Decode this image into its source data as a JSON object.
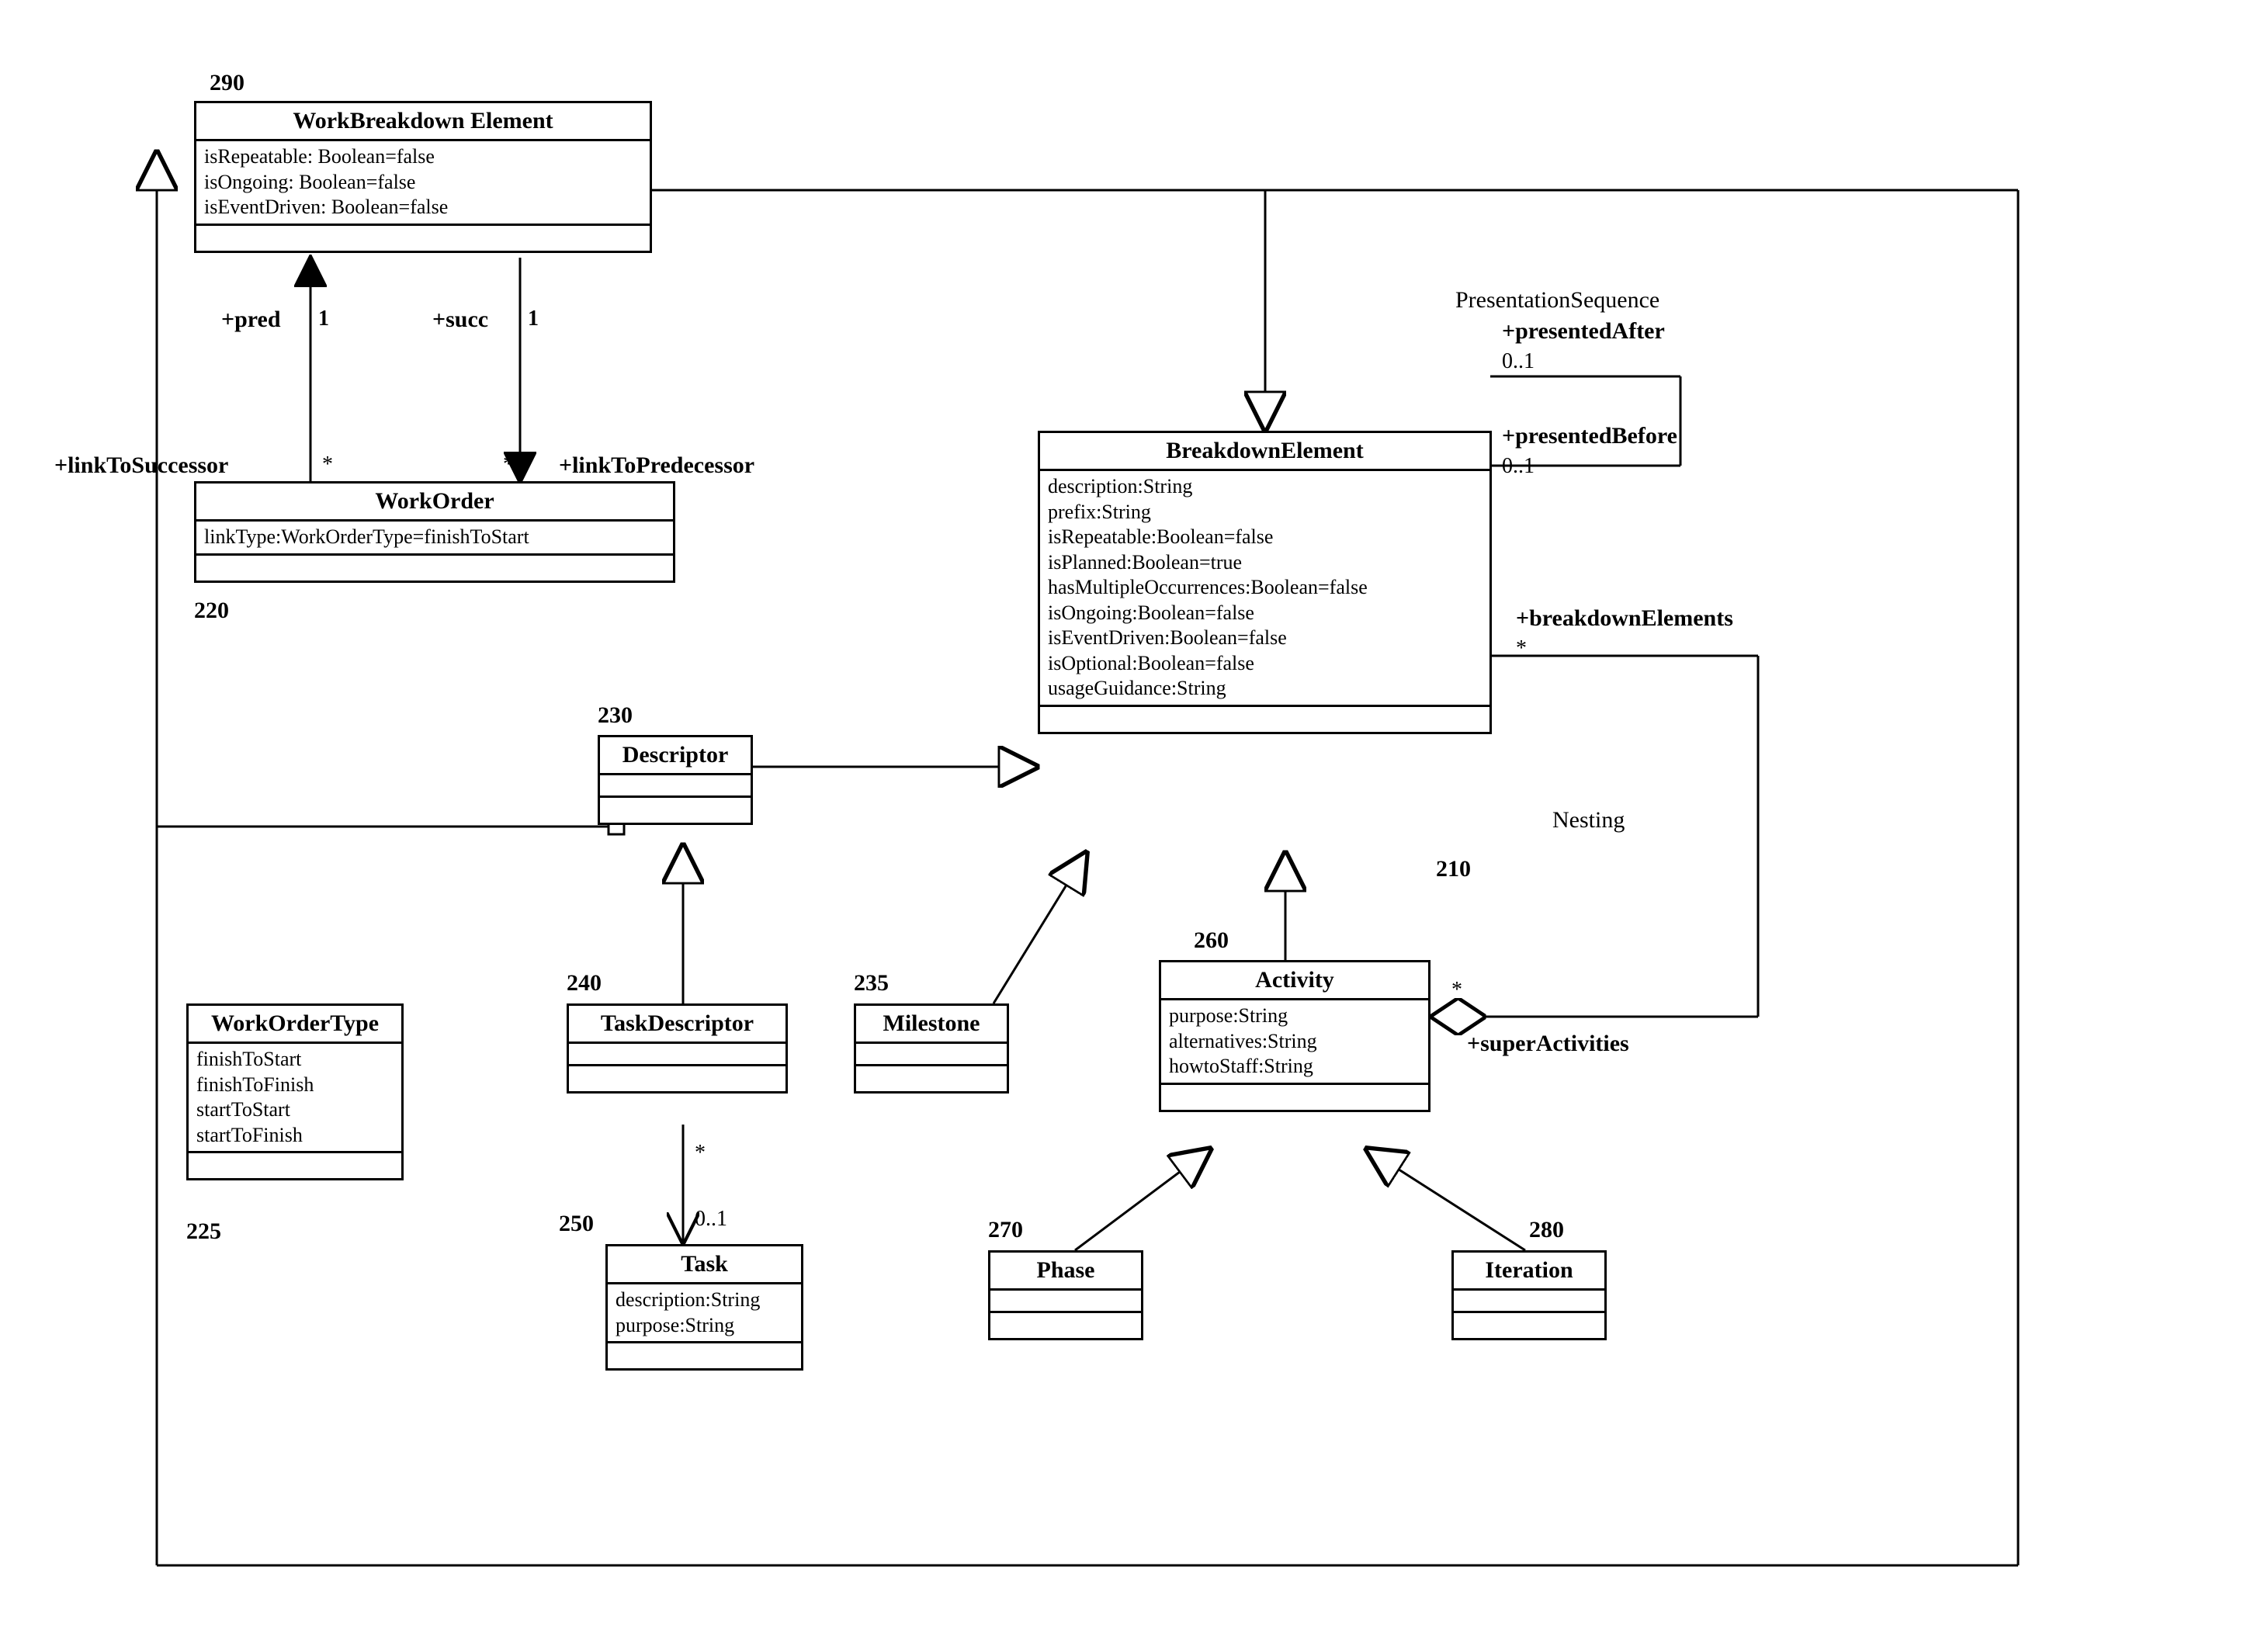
{
  "classes": {
    "workBreakdownElement": {
      "ref": "290",
      "name": "WorkBreakdown Element",
      "attrs": [
        "isRepeatable: Boolean=false",
        "isOngoing: Boolean=false",
        "isEventDriven: Boolean=false"
      ]
    },
    "workOrder": {
      "ref": "220",
      "name": "WorkOrder",
      "attrs": [
        "linkType:WorkOrderType=finishToStart"
      ]
    },
    "workOrderType": {
      "ref": "225",
      "name": "WorkOrderType",
      "attrs": [
        "finishToStart",
        "finishToFinish",
        "startToStart",
        "startToFinish"
      ]
    },
    "descriptor": {
      "ref": "230",
      "name": "Descriptor",
      "attrs": []
    },
    "taskDescriptor": {
      "ref": "240",
      "name": "TaskDescriptor",
      "attrs": []
    },
    "task": {
      "ref": "250",
      "name": "Task",
      "attrs": [
        "description:String",
        "purpose:String"
      ]
    },
    "milestone": {
      "ref": "235",
      "name": "Milestone",
      "attrs": []
    },
    "breakdownElement": {
      "ref": "210",
      "name": "BreakdownElement",
      "attrs": [
        "description:String",
        "prefix:String",
        "isRepeatable:Boolean=false",
        "isPlanned:Boolean=true",
        "hasMultipleOccurrences:Boolean=false",
        "isOngoing:Boolean=false",
        "isEventDriven:Boolean=false",
        "isOptional:Boolean=false",
        "usageGuidance:String"
      ]
    },
    "activity": {
      "ref": "260",
      "name": "Activity",
      "attrs": [
        "purpose:String",
        "alternatives:String",
        "howtoStaff:String"
      ]
    },
    "phase": {
      "ref": "270",
      "name": "Phase",
      "attrs": []
    },
    "iteration": {
      "ref": "280",
      "name": "Iteration",
      "attrs": []
    }
  },
  "labels": {
    "pred": "+pred",
    "succ": "+succ",
    "predMult": "1",
    "succMult": "1",
    "linkToSuccessor": "+linkToSuccessor",
    "linkToPredecessor": "+linkToPredecessor",
    "starA": "*",
    "starB": "*",
    "presentationSequence": "PresentationSequence",
    "presentedAfter": "+presentedAfter",
    "presentedBefore": "+presentedBefore",
    "zeroOne1": "0..1",
    "zeroOne2": "0..1",
    "breakdownElements": "+breakdownElements",
    "breakdownElementsMult": "*",
    "nesting": "Nesting",
    "superActivities": "+superActivities",
    "superActivitiesMult": "*",
    "taskStar": "*",
    "taskZeroOne": "0..1"
  }
}
